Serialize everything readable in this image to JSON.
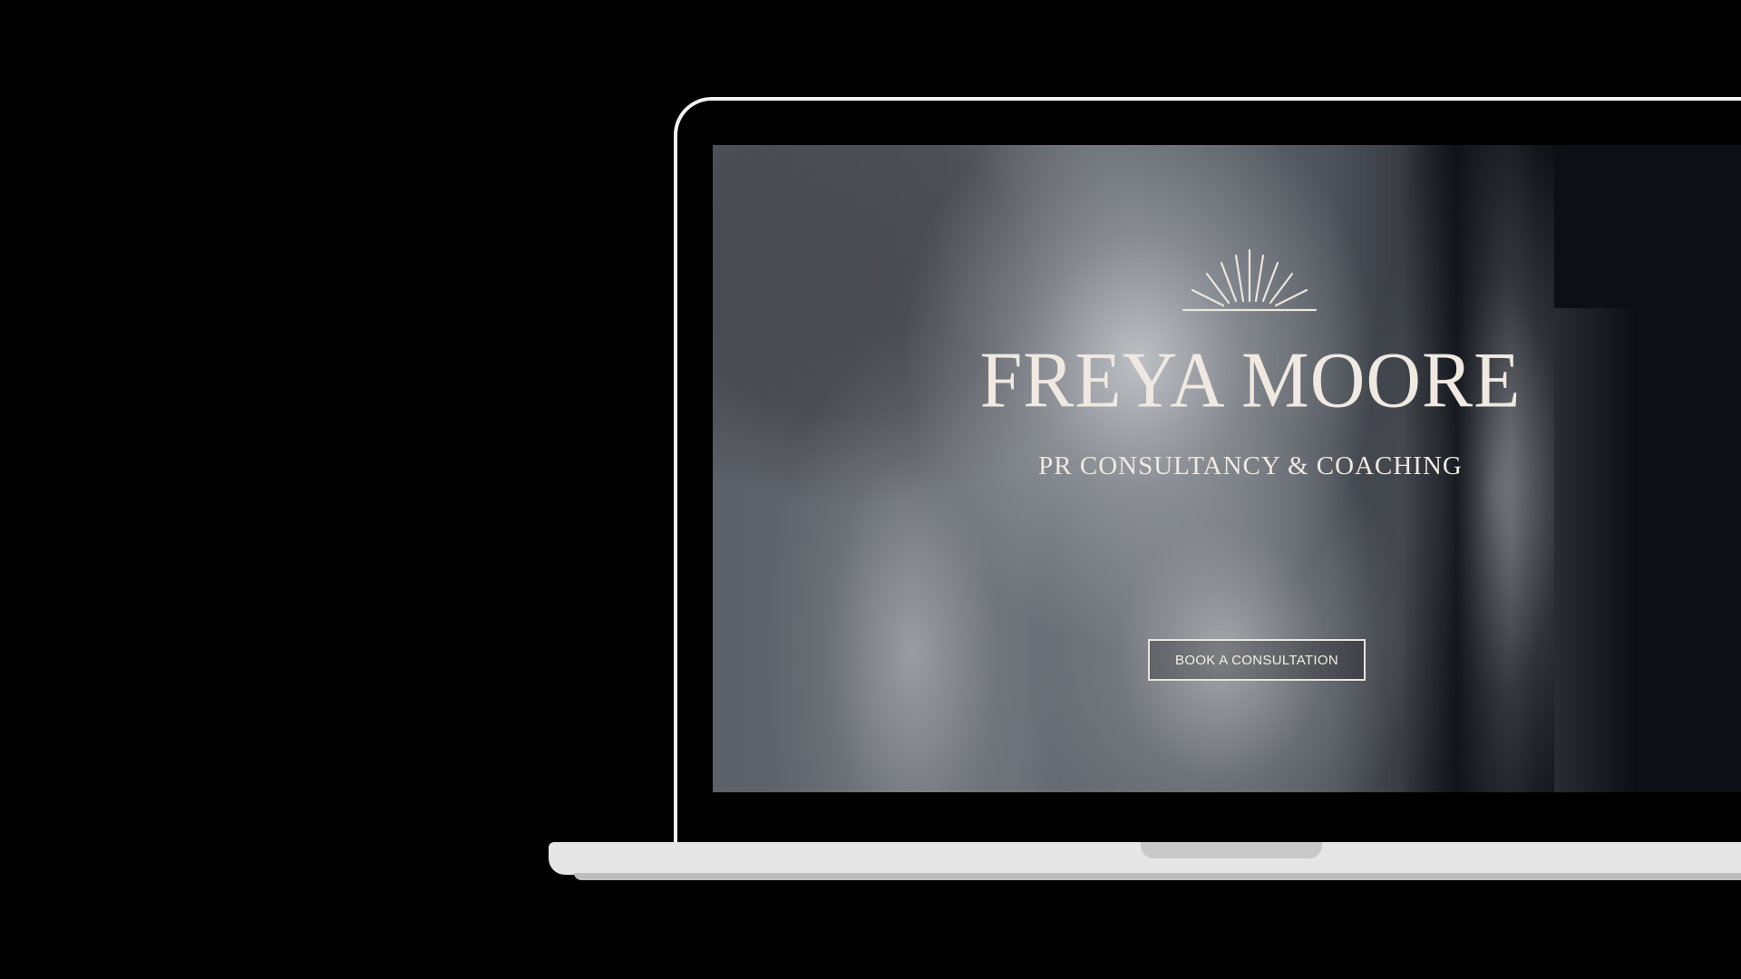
{
  "hero": {
    "brand_name": "FREYA MOORE",
    "tagline": "PR CONSULTANCY & COACHING",
    "cta_label": "BOOK A CONSULTATION",
    "logo_icon": "sun-rays-icon"
  },
  "colors": {
    "text": "#efe9e1",
    "background": "#000000",
    "laptop_frame": "#f2f2f2",
    "laptop_base": "#e6e6e6"
  }
}
